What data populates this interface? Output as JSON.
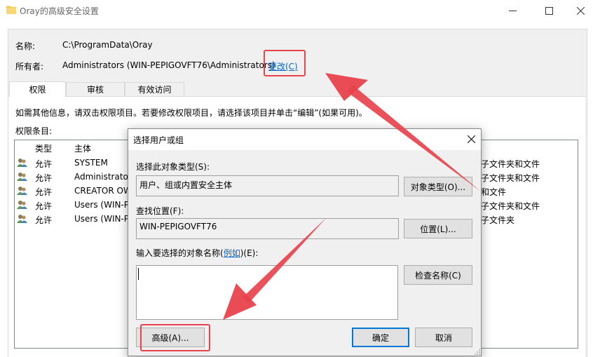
{
  "window": {
    "title": "Oray的高级安全设置",
    "icons": {
      "folder": "folder-icon",
      "minimize": "minimize-icon",
      "maximize": "maximize-icon",
      "close": "close-icon"
    }
  },
  "info": {
    "name_label": "名称:",
    "name_value": "C:\\ProgramData\\Oray",
    "owner_label": "所有者:",
    "owner_value": "Administrators (WIN-PEPIGOVFT76\\Administrators)",
    "change_link": "更改(C)"
  },
  "tabs": [
    {
      "label": "权限",
      "active": true
    },
    {
      "label": "审核",
      "active": false
    },
    {
      "label": "有效访问",
      "active": false
    }
  ],
  "permissions": {
    "instruction": "如需其他信息，请双击权限项目。若要修改权限项目，请选择该项目并单击“编辑”(如果可用)。",
    "entries_label": "权限条目:",
    "columns": {
      "type": "类型",
      "principal": "主体"
    },
    "rows": [
      {
        "type": "允许",
        "principal": "SYSTEM",
        "applies": "子文件夹和文件"
      },
      {
        "type": "允许",
        "principal": "Administrator",
        "applies": "子文件夹和文件"
      },
      {
        "type": "允许",
        "principal": "CREATOR OW",
        "applies": "和文件"
      },
      {
        "type": "允许",
        "principal": "Users (WIN-P",
        "applies": "子文件夹和文件"
      },
      {
        "type": "允许",
        "principal": "Users (WIN-P",
        "applies": "子文件夹"
      }
    ]
  },
  "dialog": {
    "title": "选择用户或组",
    "object_type_label": "选择此对象类型(S):",
    "object_type_value": "用户、组或内置安全主体",
    "object_type_button": "对象类型(O)...",
    "location_label": "查找位置(F):",
    "location_value": "WIN-PEPIGOVFT76",
    "location_button": "位置(L)...",
    "names_label_before": "输入要选择的对象名称(",
    "names_label_link": "例如",
    "names_label_after": ")(E):",
    "names_value": "",
    "check_names_button": "检查名称(C)",
    "advanced_button": "高级(A)...",
    "ok_button": "确定",
    "cancel_button": "取消"
  },
  "colors": {
    "annotation_red": "#e8424c",
    "link_blue": "#0066cc",
    "default_button_border": "#0078d7"
  }
}
